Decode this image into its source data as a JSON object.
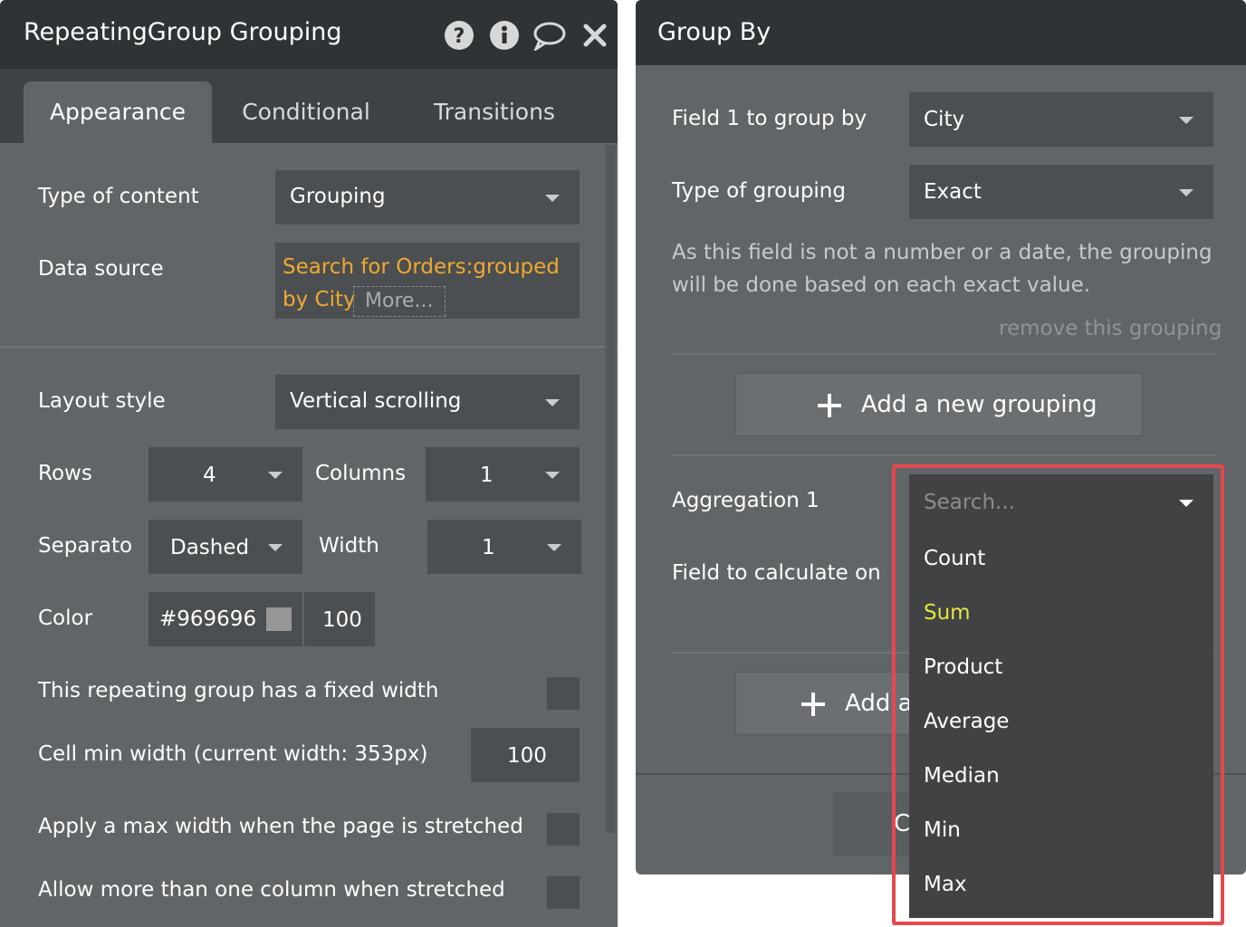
{
  "left_panel": {
    "title": "RepeatingGroup Grouping",
    "icons": [
      "help-icon",
      "info-icon",
      "comment-icon",
      "close-icon"
    ],
    "tabs": [
      "Appearance",
      "Conditional",
      "Transitions"
    ],
    "active_tab": "Appearance",
    "type_of_content": {
      "label": "Type of content",
      "value": "Grouping"
    },
    "data_source": {
      "label": "Data source",
      "line1": "Search for Orders:grouped",
      "line2": "by City",
      "more": "More..."
    },
    "layout_style": {
      "label": "Layout style",
      "value": "Vertical scrolling"
    },
    "rows": {
      "label": "Rows",
      "value": "4"
    },
    "columns": {
      "label": "Columns",
      "value": "1"
    },
    "separator": {
      "label": "Separato",
      "value": "Dashed"
    },
    "width": {
      "label": "Width",
      "value": "1"
    },
    "color": {
      "label": "Color",
      "hex": "#969696",
      "opacity": "100",
      "swatch": "#969696"
    },
    "fixed_width": {
      "label": "This repeating group has a fixed width"
    },
    "cell_min_width": {
      "label": "Cell min width (current width: 353px)",
      "value": "100"
    },
    "max_width": {
      "label": "Apply a max width when the page is stretched"
    },
    "more_columns": {
      "label": "Allow more than one column when stretched"
    }
  },
  "right_panel": {
    "title": "Group By",
    "field1": {
      "label": "Field 1 to group by",
      "value": "City"
    },
    "grouping_type": {
      "label": "Type of grouping",
      "value": "Exact"
    },
    "note_line1": "As this field is not a number or a date, the grouping",
    "note_line2": "will be done based on each exact value.",
    "remove_link": "remove this grouping",
    "add_grouping_button": "Add a new grouping",
    "aggregation_label": "Aggregation 1",
    "field_calc_label": "Field to calculate on",
    "add_aggregation_button_partial": "Add a",
    "bottom_button_partial": "C"
  },
  "dropdown": {
    "search_placeholder": "Search...",
    "options": [
      "Count",
      "Sum",
      "Product",
      "Average",
      "Median",
      "Min",
      "Max"
    ],
    "highlighted_option": "Sum",
    "highlight_color": "#e5e53f"
  },
  "colors": {
    "panel": "#616567",
    "titlebar": "#2f3335",
    "link": "#f0a830",
    "callout_border": "#e5484d"
  }
}
